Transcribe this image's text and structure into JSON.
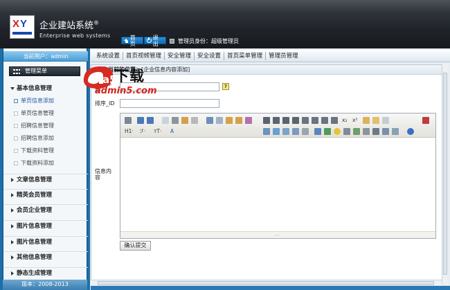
{
  "header": {
    "system_title": "企业建站系统",
    "registered_mark": "®",
    "system_subtitle": "Enterprise web systems",
    "home_label": "首页",
    "logout_label": "退出",
    "admin_info": "管理员身份：超级管理员",
    "logo_letters": "XY"
  },
  "sidebar": {
    "current_user": "当前用户：admin",
    "menu_title": "管理菜单",
    "categories": [
      {
        "label": "基本信息管理",
        "open": true
      },
      {
        "label": "文章信息管理"
      },
      {
        "label": "精英会员管理"
      },
      {
        "label": "会员企业管理"
      },
      {
        "label": "图片信息管理"
      },
      {
        "label": "图片信息管理"
      },
      {
        "label": "其他信息管理"
      },
      {
        "label": "静态生成管理"
      }
    ],
    "sub_items": [
      "单页信息添加",
      "单页信息管理",
      "招聘信息管理",
      "招聘信息添加",
      "下载资料管理",
      "下载资料添加"
    ],
    "copyright": "版本：2008-2013"
  },
  "topnav": {
    "items": [
      "系统设置",
      "首页视频管理",
      "安全管理",
      "安全设置",
      "首页菜单管理",
      "管理员管理"
    ]
  },
  "main": {
    "breadcrumb_label": "你当前的位置：",
    "breadcrumb_path": "[企业信息内容添加]",
    "title_label": "网页标题",
    "title_value": "",
    "help_label": "?",
    "sort_label": "排序_ID",
    "sort_value": "",
    "content_label": "信息内容",
    "submit_label": "确认提交",
    "toolbar_text": {
      "heading": "H1·",
      "font": "ℱ·",
      "size": "тT·",
      "font_color": "A",
      "superscript": "x²",
      "subscript": "x₂"
    }
  },
  "watermark": {
    "badge": "a5",
    "text": "下载",
    "url": "admin5.com"
  }
}
